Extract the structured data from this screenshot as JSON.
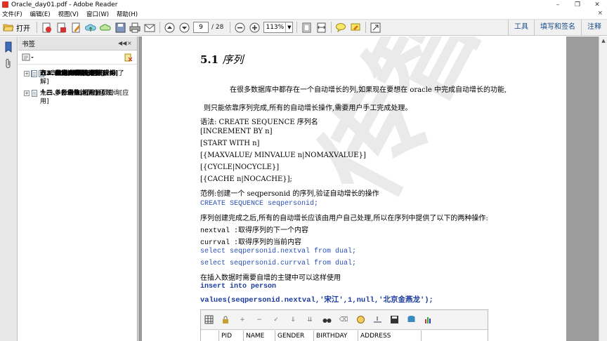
{
  "window": {
    "title": "Oracle_day01.pdf - Adobe Reader",
    "minimize": "–",
    "maximize": "❐",
    "close": "✕"
  },
  "menu": {
    "items": [
      "文件(F)",
      "编辑(E)",
      "视图(V)",
      "窗口(W)",
      "帮助(H)"
    ],
    "close_doc": "×"
  },
  "toolbar": {
    "open_label": "打开",
    "page_current": "9",
    "page_total": "/ 28",
    "zoom_value": "113%",
    "zoom_dropdown": "▼",
    "right_links": [
      "工具",
      "填写和签名",
      "注释"
    ]
  },
  "bookmarks": {
    "header": "书签",
    "collapse_btn": "◀◀",
    "close_btn": "×",
    "items": [
      {
        "text": "第1章 Oracle第一天",
        "indent": 0,
        "kind": "root"
      },
      {
        "text": "一、 oracle介绍[了解]",
        "indent": 1,
        "kind": "exp"
      },
      {
        "text": "二、 Oracle安装[了解]",
        "indent": 1,
        "kind": "exp"
      },
      {
        "text": "三、 Oracle体系结构[理解]",
        "indent": 1,
        "kind": "open"
      },
      {
        "text": "1. 数据库",
        "indent": 2,
        "kind": "page"
      },
      {
        "text": "2. 实例",
        "indent": 2,
        "kind": "page"
      },
      {
        "text": "3. 用户",
        "indent": 2,
        "kind": "page"
      },
      {
        "text": "4. 表空间",
        "indent": 2,
        "kind": "page"
      },
      {
        "text": "5. 数据文件（dbf、ora）",
        "indent": 2,
        "kind": "page"
      },
      {
        "text": "四、 创建表空间[理解]",
        "indent": 1,
        "kind": "page",
        "selected": true
      },
      {
        "text": "五、 用户[理解]",
        "indent": 1,
        "kind": "exp"
      },
      {
        "text": "六、 Oracle数据类型[应用]",
        "indent": 1,
        "kind": "page"
      },
      {
        "text": "七、 表的管理[应用]",
        "indent": 1,
        "kind": "exp"
      },
      {
        "text": "八、 Scott用户下的表结构[了解]",
        "indent": 1,
        "kind": "page",
        "wrap": true
      },
      {
        "text": "九、 单行函数[应用]",
        "indent": 1,
        "kind": "exp"
      },
      {
        "text": "十、 多行函数（聚合函数）",
        "indent": 1,
        "kind": "exp"
      },
      {
        "text": "十一、 分组统计",
        "indent": 1,
        "kind": "page"
      },
      {
        "text": "十二、 多表查询[应用]",
        "indent": 1,
        "kind": "exp"
      },
      {
        "text": "十三、 子查询[应用]",
        "indent": 1,
        "kind": "exp"
      },
      {
        "text": "十四、 Rownum与分页查询[应用]",
        "indent": 1,
        "kind": "page",
        "wrap": true
      }
    ]
  },
  "doc": {
    "heading_num": "5.1",
    "heading_text": "序列",
    "para1": "在很多数据库中都存在一个自动增长的列,如果现在要想在 oracle 中完成自动增长的功能,",
    "para2": "则只能依靠序列完成,所有的自动增长操作,需要用户手工完成处理。",
    "syntax_label": "语法: CREATE SEQUENCE 序列名",
    "syntax_lines": [
      "[INCREMENT BY n]",
      "[START WITH n]",
      "[{MAXVALUE/ MINVALUE n|NOMAXVALUE}]",
      "[{CYCLE|NOCYCLE}]",
      "[{CACHE n|NOCACHE}];"
    ],
    "example_label": "范例:创建一个 seqpersonid 的序列,验证自动增长的操作",
    "create_stmt": "CREATE SEQUENCE seqpersonid;",
    "after_create": "序列创建完成之后,所有的自动增长应该由用户自己处理,所以在序列中提供了以下的两种操作:",
    "nextval_desc": "nextval :取得序列的下一个内容",
    "currval_desc": "currval :取得序列的当前内容",
    "select1": "select seqpersonid.nextval from dual;",
    "select2": "select seqpersonid.currval from dual;",
    "insert_desc": "在插入数据时需要自增的主键中可以这样使用",
    "insert_kw": "insert into person",
    "values_stmt": "values(seqpersonid.nextval,'宋江',1,null,'北京金燕龙');",
    "watermark": "传智播客"
  },
  "embed": {
    "columns": [
      "PID",
      "NAME",
      "GENDER",
      "BIRTHDAY",
      "ADDRESS"
    ]
  },
  "colors": {
    "code_blue": "#2a4fb0",
    "link_blue": "#1a4d8c",
    "toolbar_bg": "#f0f0f0",
    "doc_bg": "#9c9c9c"
  }
}
